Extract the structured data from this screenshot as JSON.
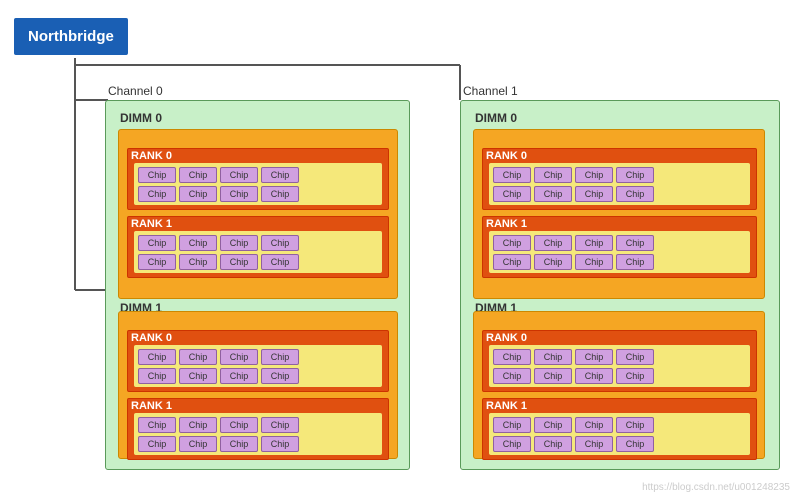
{
  "northbridge": {
    "label": "Northbridge"
  },
  "channels": [
    {
      "id": "channel-0",
      "label": "Channel 0",
      "dimms": [
        {
          "id": "dimm-0",
          "label": "DIMM 0",
          "ranks": [
            {
              "id": "rank-0",
              "label": "RANK 0",
              "rows": [
                [
                  "Chip",
                  "Chip",
                  "Chip",
                  "Chip"
                ],
                [
                  "Chip",
                  "Chip",
                  "Chip",
                  "Chip"
                ]
              ]
            },
            {
              "id": "rank-1",
              "label": "RANK 1",
              "rows": [
                [
                  "Chip",
                  "Chip",
                  "Chip",
                  "Chip"
                ],
                [
                  "Chip",
                  "Chip",
                  "Chip",
                  "Chip"
                ]
              ]
            }
          ]
        },
        {
          "id": "dimm-1",
          "label": "DIMM 1",
          "ranks": [
            {
              "id": "rank-0",
              "label": "RANK 0",
              "rows": [
                [
                  "Chip",
                  "Chip",
                  "Chip",
                  "Chip"
                ],
                [
                  "Chip",
                  "Chip",
                  "Chip",
                  "Chip"
                ]
              ]
            },
            {
              "id": "rank-1",
              "label": "RANK 1",
              "rows": [
                [
                  "Chip",
                  "Chip",
                  "Chip",
                  "Chip"
                ],
                [
                  "Chip",
                  "Chip",
                  "Chip",
                  "Chip"
                ]
              ]
            }
          ]
        }
      ]
    },
    {
      "id": "channel-1",
      "label": "Channel 1",
      "dimms": [
        {
          "id": "dimm-0",
          "label": "DIMM 0",
          "ranks": [
            {
              "id": "rank-0",
              "label": "RANK 0",
              "rows": [
                [
                  "Chip",
                  "Chip",
                  "Chip",
                  "Chip"
                ],
                [
                  "Chip",
                  "Chip",
                  "Chip",
                  "Chip"
                ]
              ]
            },
            {
              "id": "rank-1",
              "label": "RANK 1",
              "rows": [
                [
                  "Chip",
                  "Chip",
                  "Chip",
                  "Chip"
                ],
                [
                  "Chip",
                  "Chip",
                  "Chip",
                  "Chip"
                ]
              ]
            }
          ]
        },
        {
          "id": "dimm-1",
          "label": "DIMM 1",
          "ranks": [
            {
              "id": "rank-0",
              "label": "RANK 0",
              "rows": [
                [
                  "Chip",
                  "Chip",
                  "Chip",
                  "Chip"
                ],
                [
                  "Chip",
                  "Chip",
                  "Chip",
                  "Chip"
                ]
              ]
            },
            {
              "id": "rank-1",
              "label": "RANK 1",
              "rows": [
                [
                  "Chip",
                  "Chip",
                  "Chip",
                  "Chip"
                ],
                [
                  "Chip",
                  "Chip",
                  "Chip",
                  "Chip"
                ]
              ]
            }
          ]
        }
      ]
    }
  ],
  "watermark": "https://blog.csdn.net/u001248235"
}
